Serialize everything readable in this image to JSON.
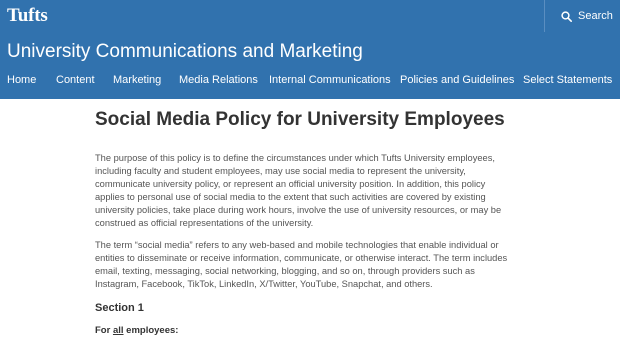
{
  "brand": {
    "logo_text": "Tufts"
  },
  "search": {
    "label": "Search",
    "icon": "search-icon"
  },
  "site": {
    "title": "University Communications and Marketing"
  },
  "nav": [
    {
      "label": "Home"
    },
    {
      "label": "Content"
    },
    {
      "label": "Marketing"
    },
    {
      "label": "Media Relations"
    },
    {
      "label": "Internal Communications"
    },
    {
      "label": "Policies and Guidelines"
    },
    {
      "label": "Select Statements"
    }
  ],
  "main": {
    "title": "Social Media Policy for University Employees",
    "paragraphs": [
      "The purpose of this policy is to define the circumstances under which Tufts University employees, including faculty and student employees, may use social media to represent the university, communicate university policy, or represent an official university position. In addition, this policy applies to personal use of social media to the extent that such activities are covered by existing university policies, take place during work hours, involve the use of university resources, or may be construed as official representations of the university.",
      "The term “social media” refers to any web-based and mobile technologies that enable individual or entities to disseminate or receive information, communicate, or otherwise interact. The term includes email, texting, messaging, social networking, blogging, and so on, through providers such as Instagram, Facebook, TikTok, LinkedIn, X/Twitter, YouTube, Snapchat, and others."
    ],
    "section_heading": "Section 1",
    "for_label_pre": "For ",
    "for_label_underlined": "all",
    "for_label_post": " employees:"
  },
  "colors": {
    "brand_blue": "#3172ae",
    "text": "#333333",
    "body_text": "#555555"
  }
}
